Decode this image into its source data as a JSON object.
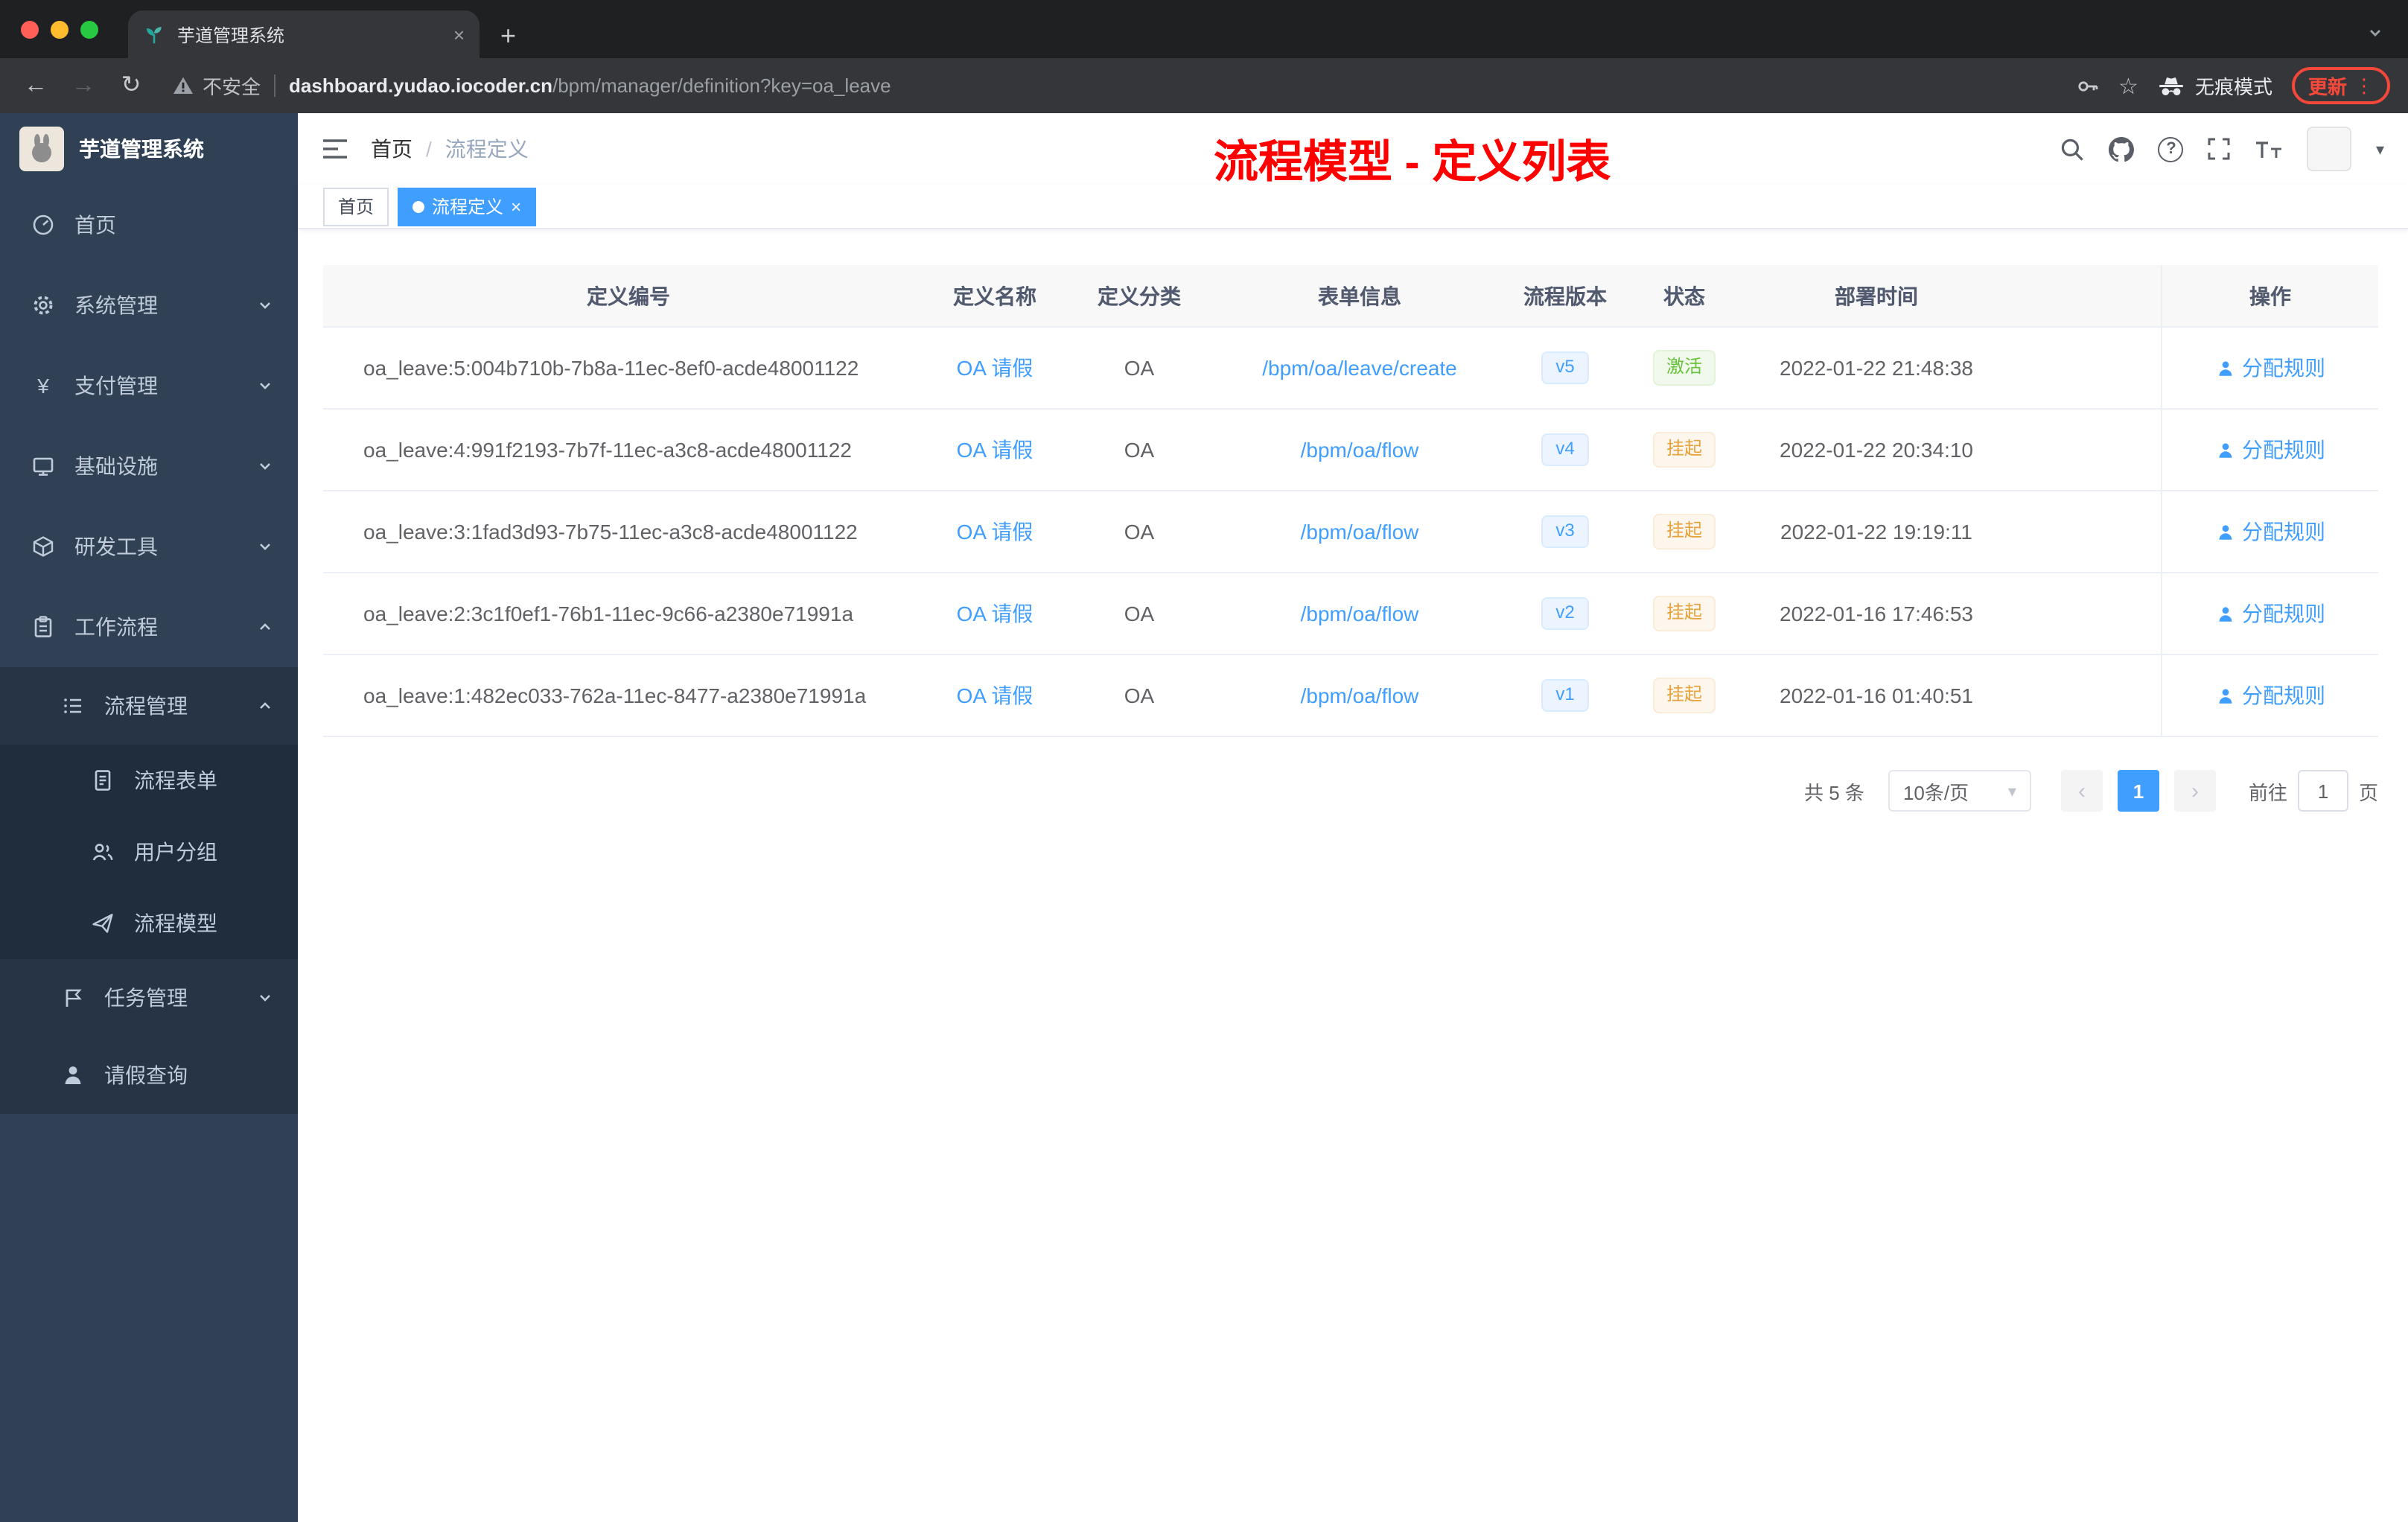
{
  "browser": {
    "tab_title": "芋道管理系统",
    "security_label": "不安全",
    "url_host": "dashboard.yudao.iocoder.cn",
    "url_path": "/bpm/manager/definition?key=oa_leave",
    "incognito_label": "无痕模式",
    "update_label": "更新"
  },
  "sidebar": {
    "logo_title": "芋道管理系统",
    "items": [
      {
        "label": "首页"
      },
      {
        "label": "系统管理"
      },
      {
        "label": "支付管理"
      },
      {
        "label": "基础设施"
      },
      {
        "label": "研发工具"
      },
      {
        "label": "工作流程"
      },
      {
        "label": "流程管理"
      },
      {
        "label": "流程表单"
      },
      {
        "label": "用户分组"
      },
      {
        "label": "流程模型"
      },
      {
        "label": "任务管理"
      },
      {
        "label": "请假查询"
      }
    ]
  },
  "header": {
    "breadcrumb_home": "首页",
    "breadcrumb_sep": "/",
    "breadcrumb_current": "流程定义",
    "annotation": "流程模型 - 定义列表"
  },
  "tags": {
    "home": "首页",
    "current": "流程定义"
  },
  "table": {
    "columns": [
      "定义编号",
      "定义名称",
      "定义分类",
      "表单信息",
      "流程版本",
      "状态",
      "部署时间",
      "操作"
    ],
    "rows": [
      {
        "id": "oa_leave:5:004b710b-7b8a-11ec-8ef0-acde48001122",
        "name": "OA 请假",
        "category": "OA",
        "form": "/bpm/oa/leave/create",
        "version": "v5",
        "status": "激活",
        "time": "2022-01-22 21:48:38",
        "action": "分配规则"
      },
      {
        "id": "oa_leave:4:991f2193-7b7f-11ec-a3c8-acde48001122",
        "name": "OA 请假",
        "category": "OA",
        "form": "/bpm/oa/flow",
        "version": "v4",
        "status": "挂起",
        "time": "2022-01-22 20:34:10",
        "action": "分配规则"
      },
      {
        "id": "oa_leave:3:1fad3d93-7b75-11ec-a3c8-acde48001122",
        "name": "OA 请假",
        "category": "OA",
        "form": "/bpm/oa/flow",
        "version": "v3",
        "status": "挂起",
        "time": "2022-01-22 19:19:11",
        "action": "分配规则"
      },
      {
        "id": "oa_leave:2:3c1f0ef1-76b1-11ec-9c66-a2380e71991a",
        "name": "OA 请假",
        "category": "OA",
        "form": "/bpm/oa/flow",
        "version": "v2",
        "status": "挂起",
        "time": "2022-01-16 17:46:53",
        "action": "分配规则"
      },
      {
        "id": "oa_leave:1:482ec033-762a-11ec-8477-a2380e71991a",
        "name": "OA 请假",
        "category": "OA",
        "form": "/bpm/oa/flow",
        "version": "v1",
        "status": "挂起",
        "time": "2022-01-16 01:40:51",
        "action": "分配规则"
      }
    ]
  },
  "pagination": {
    "total": "共 5 条",
    "page_size": "10条/页",
    "page": "1",
    "goto_label": "前往",
    "goto_value": "1",
    "goto_unit": "页"
  },
  "colors": {
    "accent": "#409eff",
    "success": "#67c23a",
    "warning": "#e6a23c",
    "annotation": "#ff0000",
    "sidebar_bg": "#304156"
  }
}
